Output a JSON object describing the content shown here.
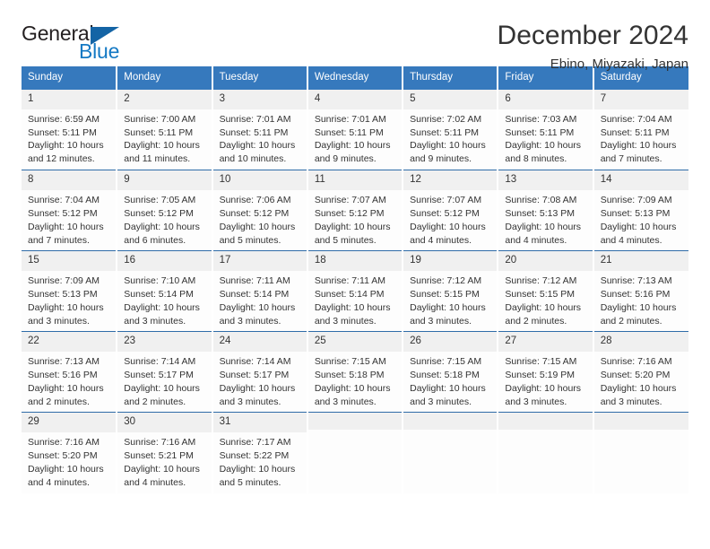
{
  "brand": {
    "name_part1": "General",
    "name_part2": "Blue",
    "flag_icon": "triangle-flag-icon",
    "accent_color": "#1479c4"
  },
  "header": {
    "title": "December 2024",
    "subtitle": "Ebino, Miyazaki, Japan"
  },
  "theme": {
    "header_row_bg": "#3679bd",
    "daynum_bg": "#f0f0f0",
    "row_divider": "#2f6ca8",
    "text": "#333333"
  },
  "calendar": {
    "weekday_headers": [
      "Sunday",
      "Monday",
      "Tuesday",
      "Wednesday",
      "Thursday",
      "Friday",
      "Saturday"
    ],
    "weeks": [
      [
        {
          "day": "1",
          "sunrise": "Sunrise: 6:59 AM",
          "sunset": "Sunset: 5:11 PM",
          "daylight_line1": "Daylight: 10 hours",
          "daylight_line2": "and 12 minutes."
        },
        {
          "day": "2",
          "sunrise": "Sunrise: 7:00 AM",
          "sunset": "Sunset: 5:11 PM",
          "daylight_line1": "Daylight: 10 hours",
          "daylight_line2": "and 11 minutes."
        },
        {
          "day": "3",
          "sunrise": "Sunrise: 7:01 AM",
          "sunset": "Sunset: 5:11 PM",
          "daylight_line1": "Daylight: 10 hours",
          "daylight_line2": "and 10 minutes."
        },
        {
          "day": "4",
          "sunrise": "Sunrise: 7:01 AM",
          "sunset": "Sunset: 5:11 PM",
          "daylight_line1": "Daylight: 10 hours",
          "daylight_line2": "and 9 minutes."
        },
        {
          "day": "5",
          "sunrise": "Sunrise: 7:02 AM",
          "sunset": "Sunset: 5:11 PM",
          "daylight_line1": "Daylight: 10 hours",
          "daylight_line2": "and 9 minutes."
        },
        {
          "day": "6",
          "sunrise": "Sunrise: 7:03 AM",
          "sunset": "Sunset: 5:11 PM",
          "daylight_line1": "Daylight: 10 hours",
          "daylight_line2": "and 8 minutes."
        },
        {
          "day": "7",
          "sunrise": "Sunrise: 7:04 AM",
          "sunset": "Sunset: 5:11 PM",
          "daylight_line1": "Daylight: 10 hours",
          "daylight_line2": "and 7 minutes."
        }
      ],
      [
        {
          "day": "8",
          "sunrise": "Sunrise: 7:04 AM",
          "sunset": "Sunset: 5:12 PM",
          "daylight_line1": "Daylight: 10 hours",
          "daylight_line2": "and 7 minutes."
        },
        {
          "day": "9",
          "sunrise": "Sunrise: 7:05 AM",
          "sunset": "Sunset: 5:12 PM",
          "daylight_line1": "Daylight: 10 hours",
          "daylight_line2": "and 6 minutes."
        },
        {
          "day": "10",
          "sunrise": "Sunrise: 7:06 AM",
          "sunset": "Sunset: 5:12 PM",
          "daylight_line1": "Daylight: 10 hours",
          "daylight_line2": "and 5 minutes."
        },
        {
          "day": "11",
          "sunrise": "Sunrise: 7:07 AM",
          "sunset": "Sunset: 5:12 PM",
          "daylight_line1": "Daylight: 10 hours",
          "daylight_line2": "and 5 minutes."
        },
        {
          "day": "12",
          "sunrise": "Sunrise: 7:07 AM",
          "sunset": "Sunset: 5:12 PM",
          "daylight_line1": "Daylight: 10 hours",
          "daylight_line2": "and 4 minutes."
        },
        {
          "day": "13",
          "sunrise": "Sunrise: 7:08 AM",
          "sunset": "Sunset: 5:13 PM",
          "daylight_line1": "Daylight: 10 hours",
          "daylight_line2": "and 4 minutes."
        },
        {
          "day": "14",
          "sunrise": "Sunrise: 7:09 AM",
          "sunset": "Sunset: 5:13 PM",
          "daylight_line1": "Daylight: 10 hours",
          "daylight_line2": "and 4 minutes."
        }
      ],
      [
        {
          "day": "15",
          "sunrise": "Sunrise: 7:09 AM",
          "sunset": "Sunset: 5:13 PM",
          "daylight_line1": "Daylight: 10 hours",
          "daylight_line2": "and 3 minutes."
        },
        {
          "day": "16",
          "sunrise": "Sunrise: 7:10 AM",
          "sunset": "Sunset: 5:14 PM",
          "daylight_line1": "Daylight: 10 hours",
          "daylight_line2": "and 3 minutes."
        },
        {
          "day": "17",
          "sunrise": "Sunrise: 7:11 AM",
          "sunset": "Sunset: 5:14 PM",
          "daylight_line1": "Daylight: 10 hours",
          "daylight_line2": "and 3 minutes."
        },
        {
          "day": "18",
          "sunrise": "Sunrise: 7:11 AM",
          "sunset": "Sunset: 5:14 PM",
          "daylight_line1": "Daylight: 10 hours",
          "daylight_line2": "and 3 minutes."
        },
        {
          "day": "19",
          "sunrise": "Sunrise: 7:12 AM",
          "sunset": "Sunset: 5:15 PM",
          "daylight_line1": "Daylight: 10 hours",
          "daylight_line2": "and 3 minutes."
        },
        {
          "day": "20",
          "sunrise": "Sunrise: 7:12 AM",
          "sunset": "Sunset: 5:15 PM",
          "daylight_line1": "Daylight: 10 hours",
          "daylight_line2": "and 2 minutes."
        },
        {
          "day": "21",
          "sunrise": "Sunrise: 7:13 AM",
          "sunset": "Sunset: 5:16 PM",
          "daylight_line1": "Daylight: 10 hours",
          "daylight_line2": "and 2 minutes."
        }
      ],
      [
        {
          "day": "22",
          "sunrise": "Sunrise: 7:13 AM",
          "sunset": "Sunset: 5:16 PM",
          "daylight_line1": "Daylight: 10 hours",
          "daylight_line2": "and 2 minutes."
        },
        {
          "day": "23",
          "sunrise": "Sunrise: 7:14 AM",
          "sunset": "Sunset: 5:17 PM",
          "daylight_line1": "Daylight: 10 hours",
          "daylight_line2": "and 2 minutes."
        },
        {
          "day": "24",
          "sunrise": "Sunrise: 7:14 AM",
          "sunset": "Sunset: 5:17 PM",
          "daylight_line1": "Daylight: 10 hours",
          "daylight_line2": "and 3 minutes."
        },
        {
          "day": "25",
          "sunrise": "Sunrise: 7:15 AM",
          "sunset": "Sunset: 5:18 PM",
          "daylight_line1": "Daylight: 10 hours",
          "daylight_line2": "and 3 minutes."
        },
        {
          "day": "26",
          "sunrise": "Sunrise: 7:15 AM",
          "sunset": "Sunset: 5:18 PM",
          "daylight_line1": "Daylight: 10 hours",
          "daylight_line2": "and 3 minutes."
        },
        {
          "day": "27",
          "sunrise": "Sunrise: 7:15 AM",
          "sunset": "Sunset: 5:19 PM",
          "daylight_line1": "Daylight: 10 hours",
          "daylight_line2": "and 3 minutes."
        },
        {
          "day": "28",
          "sunrise": "Sunrise: 7:16 AM",
          "sunset": "Sunset: 5:20 PM",
          "daylight_line1": "Daylight: 10 hours",
          "daylight_line2": "and 3 minutes."
        }
      ],
      [
        {
          "day": "29",
          "sunrise": "Sunrise: 7:16 AM",
          "sunset": "Sunset: 5:20 PM",
          "daylight_line1": "Daylight: 10 hours",
          "daylight_line2": "and 4 minutes."
        },
        {
          "day": "30",
          "sunrise": "Sunrise: 7:16 AM",
          "sunset": "Sunset: 5:21 PM",
          "daylight_line1": "Daylight: 10 hours",
          "daylight_line2": "and 4 minutes."
        },
        {
          "day": "31",
          "sunrise": "Sunrise: 7:17 AM",
          "sunset": "Sunset: 5:22 PM",
          "daylight_line1": "Daylight: 10 hours",
          "daylight_line2": "and 5 minutes."
        },
        {
          "day": "",
          "sunrise": "",
          "sunset": "",
          "daylight_line1": "",
          "daylight_line2": ""
        },
        {
          "day": "",
          "sunrise": "",
          "sunset": "",
          "daylight_line1": "",
          "daylight_line2": ""
        },
        {
          "day": "",
          "sunrise": "",
          "sunset": "",
          "daylight_line1": "",
          "daylight_line2": ""
        },
        {
          "day": "",
          "sunrise": "",
          "sunset": "",
          "daylight_line1": "",
          "daylight_line2": ""
        }
      ]
    ]
  }
}
